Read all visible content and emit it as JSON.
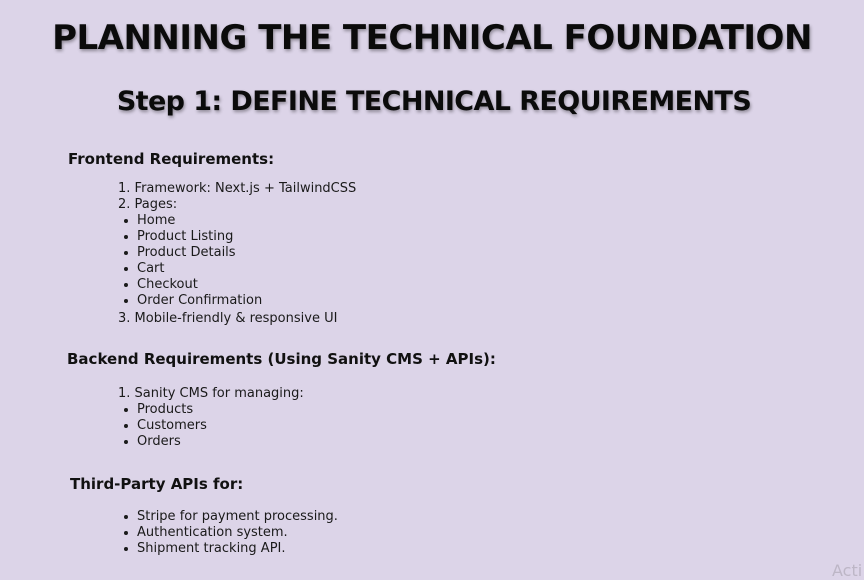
{
  "title": "PLANNING THE TECHNICAL FOUNDATION",
  "subtitle": "Step 1: DEFINE TECHNICAL REQUIREMENTS",
  "frontend": {
    "heading": "Frontend Requirements:",
    "framework": "1. Framework: Next.js + TailwindCSS",
    "pages_label": "2. Pages:",
    "pages": [
      "Home",
      "Product Listing",
      "Product Details",
      "Cart",
      "Checkout",
      "Order Confirmation"
    ],
    "responsive": "3. Mobile-friendly & responsive UI"
  },
  "backend": {
    "heading": "Backend Requirements (Using Sanity CMS + APIs):",
    "cms_label": "1. Sanity CMS for managing:",
    "items": [
      "Products",
      "Customers",
      "Orders"
    ]
  },
  "third_party": {
    "heading": "Third-Party APIs for:",
    "items": [
      "Stripe for payment processing.",
      "Authentication system.",
      "Shipment tracking API."
    ]
  },
  "watermark": "Acti"
}
